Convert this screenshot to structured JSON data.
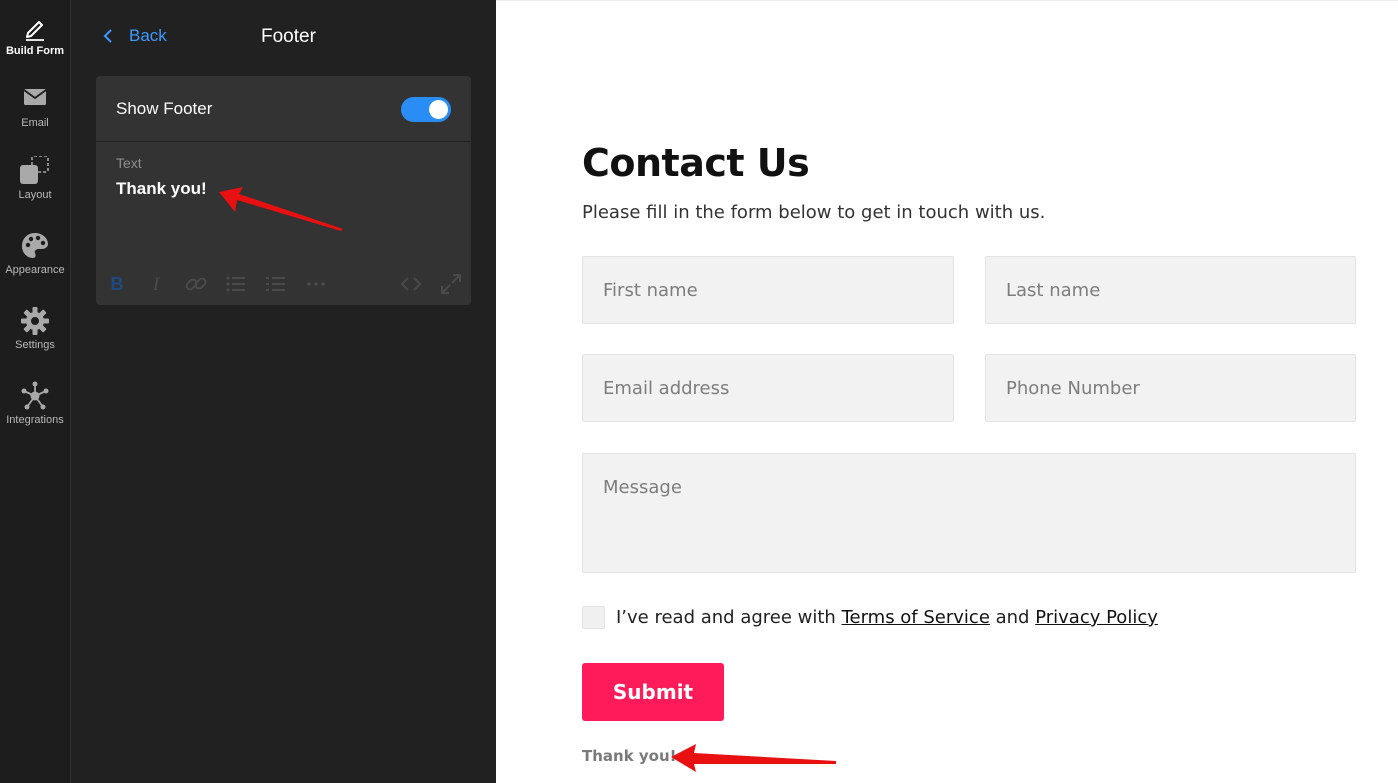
{
  "sidebar": {
    "items": [
      {
        "label": "Build Form",
        "icon": "pencil-icon"
      },
      {
        "label": "Email",
        "icon": "envelope-icon"
      },
      {
        "label": "Layout",
        "icon": "layout-icon"
      },
      {
        "label": "Appearance",
        "icon": "palette-icon"
      },
      {
        "label": "Settings",
        "icon": "gear-icon"
      },
      {
        "label": "Integrations",
        "icon": "integrations-icon"
      }
    ],
    "active_index": 0
  },
  "panel": {
    "back_label": "Back",
    "title": "Footer",
    "show_footer_label": "Show Footer",
    "show_footer_enabled": true,
    "text_field_label": "Text",
    "text_field_value": "Thank you!",
    "toolbar_icons": [
      "bold-icon",
      "italic-icon",
      "link-icon",
      "bulleted-list-icon",
      "numbered-list-icon",
      "more-icon",
      "code-icon",
      "expand-icon"
    ]
  },
  "form": {
    "title": "Contact Us",
    "subtitle": "Please fill in the form below to get in touch with us.",
    "placeholders": {
      "first_name": "First name",
      "last_name": "Last name",
      "email": "Email address",
      "phone": "Phone Number",
      "message": "Message"
    },
    "agree_prefix": "I’ve read and agree with ",
    "terms_link": "Terms of Service",
    "agree_and": " and ",
    "privacy_link": "Privacy Policy",
    "submit_label": "Submit",
    "footer_text": "Thank you!"
  },
  "colors": {
    "accent_blue": "#2a8df5",
    "submit_pink": "#ff1a5a",
    "annotation_red": "#e81010"
  }
}
